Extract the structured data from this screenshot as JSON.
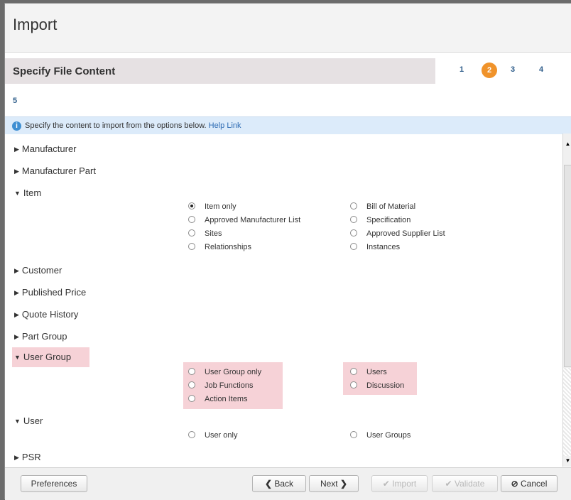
{
  "dialog": {
    "title": "Import",
    "section_title": "Specify File Content"
  },
  "steps": [
    "1",
    "2",
    "3",
    "4",
    "5"
  ],
  "current_step": "2",
  "info": {
    "text": "Specify the content to import from the options below.",
    "link": "Help Link"
  },
  "rows": {
    "manufacturer": "Manufacturer",
    "manufacturer_part": "Manufacturer Part",
    "item": "Item",
    "customer": "Customer",
    "published_price": "Published Price",
    "quote_history": "Quote History",
    "part_group": "Part Group",
    "user_group": "User Group",
    "user": "User",
    "psr": "PSR"
  },
  "item_options": {
    "col1": [
      "Item only",
      "Approved Manufacturer List",
      "Sites",
      "Relationships"
    ],
    "col2": [
      "Bill of Material",
      "Specification",
      "Approved Supplier List",
      "Instances"
    ],
    "selected": "Item only"
  },
  "user_group_options": {
    "col1": [
      "User Group only",
      "Job Functions",
      "Action Items"
    ],
    "col2": [
      "Users",
      "Discussion"
    ]
  },
  "user_options": {
    "col1": [
      "User only"
    ],
    "col2": [
      "User Groups"
    ]
  },
  "footer": {
    "preferences": "Preferences",
    "back": "Back",
    "next": "Next",
    "import": "Import",
    "validate": "Validate",
    "cancel": "Cancel"
  },
  "colors": {
    "accent": "#f0932b",
    "highlight": "#f6d2d7",
    "info_bg": "#dcebfa",
    "link": "#2d5c8a"
  }
}
